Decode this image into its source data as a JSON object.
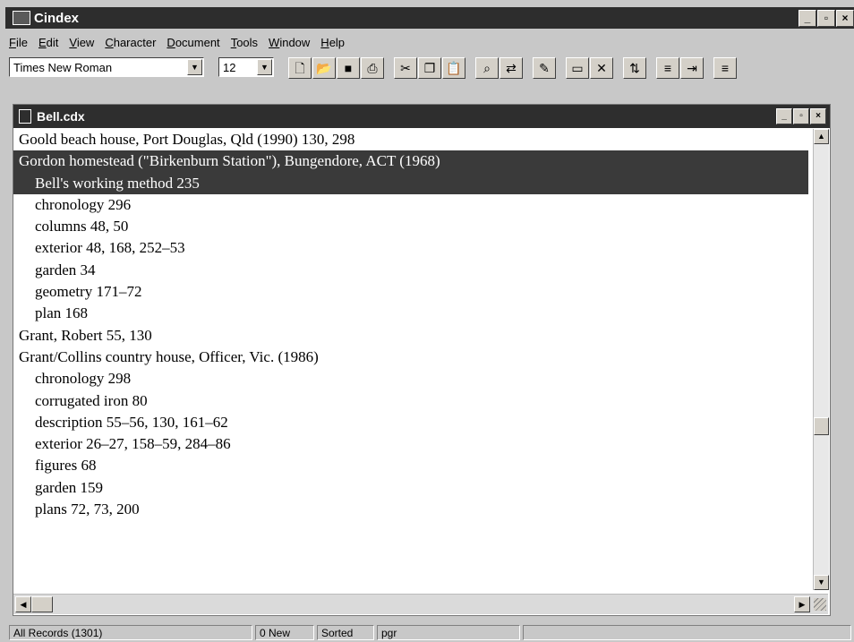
{
  "app": {
    "title": "Cindex"
  },
  "window_controls": {
    "minimize": "_",
    "maximize": "▫",
    "close": "×"
  },
  "menu": [
    "File",
    "Edit",
    "View",
    "Character",
    "Document",
    "Tools",
    "Window",
    "Help"
  ],
  "toolbar": {
    "font": "Times New Roman",
    "size": "12",
    "icons": [
      "new-file-icon",
      "open-icon",
      "save-icon",
      "print-icon",
      "cut-icon",
      "copy-icon",
      "paste-icon",
      "find-icon",
      "replace-icon",
      "edit-icon",
      "new-record-icon",
      "delete-icon",
      "sort-icon",
      "align-left-icon",
      "indent-icon",
      "align-right-icon"
    ]
  },
  "document": {
    "title": "Bell.cdx",
    "records": [
      {
        "text": "Goold beach house, Port Douglas, Qld (1990) 130, 298",
        "level": 0,
        "selected": false
      },
      {
        "text": "Gordon homestead (\"Birkenburn Station\"), Bungendore, ACT (1968)",
        "level": 0,
        "selected": true
      },
      {
        "text": "Bell's working method 235",
        "level": 1,
        "selected": true
      },
      {
        "text": "chronology 296",
        "level": 1,
        "selected": false
      },
      {
        "text": "columns 48, 50",
        "level": 1,
        "selected": false
      },
      {
        "text": "exterior 48, 168, 252–53",
        "level": 1,
        "selected": false
      },
      {
        "text": "garden 34",
        "level": 1,
        "selected": false
      },
      {
        "text": "geometry 171–72",
        "level": 1,
        "selected": false
      },
      {
        "text": "plan 168",
        "level": 1,
        "selected": false
      },
      {
        "text": "Grant, Robert 55, 130",
        "level": 0,
        "selected": false
      },
      {
        "text": "Grant/Collins country house, Officer, Vic. (1986)",
        "level": 0,
        "selected": false
      },
      {
        "text": "chronology 298",
        "level": 1,
        "selected": false
      },
      {
        "text": "corrugated iron 80",
        "level": 1,
        "selected": false
      },
      {
        "text": "description 55–56, 130, 161–62",
        "level": 1,
        "selected": false
      },
      {
        "text": "exterior 26–27, 158–59, 284–86",
        "level": 1,
        "selected": false
      },
      {
        "text": "figures 68",
        "level": 1,
        "selected": false
      },
      {
        "text": "garden 159",
        "level": 1,
        "selected": false
      },
      {
        "text": "plans 72, 73, 200",
        "level": 1,
        "selected": false
      }
    ]
  },
  "status": {
    "records": "All Records (1301)",
    "new": "0 New",
    "sorted": "Sorted",
    "field": "pgr"
  }
}
